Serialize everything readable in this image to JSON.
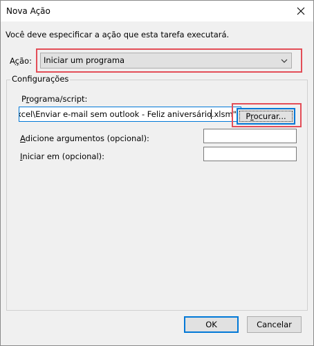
{
  "window": {
    "title": "Nova Ação"
  },
  "instruction": "Você deve especificar a ação que esta tarefa executará.",
  "action": {
    "label_prefix": "A",
    "label_underlined": "ç",
    "label_suffix": "ão:",
    "selected": "Iniciar um programa"
  },
  "settings": {
    "legend": "Configurações",
    "program": {
      "label_prefix": "P",
      "label_underlined": "r",
      "label_suffix": "ograma/script:",
      "value": ":xcel\\Enviar e-mail sem outlook - Feliz aniversário.xlsm\""
    },
    "browse": {
      "prefix": "P",
      "underlined": "r",
      "suffix": "ocurar..."
    },
    "arguments": {
      "label_underlined": "A",
      "label_suffix": "dicione argumentos (opcional):",
      "value": ""
    },
    "start_in": {
      "label_underlined": "I",
      "label_suffix": "niciar em (opcional):",
      "value": ""
    }
  },
  "buttons": {
    "ok": "OK",
    "cancel": "Cancelar"
  },
  "colors": {
    "highlight": "#e34d57",
    "focus": "#0078d7"
  }
}
